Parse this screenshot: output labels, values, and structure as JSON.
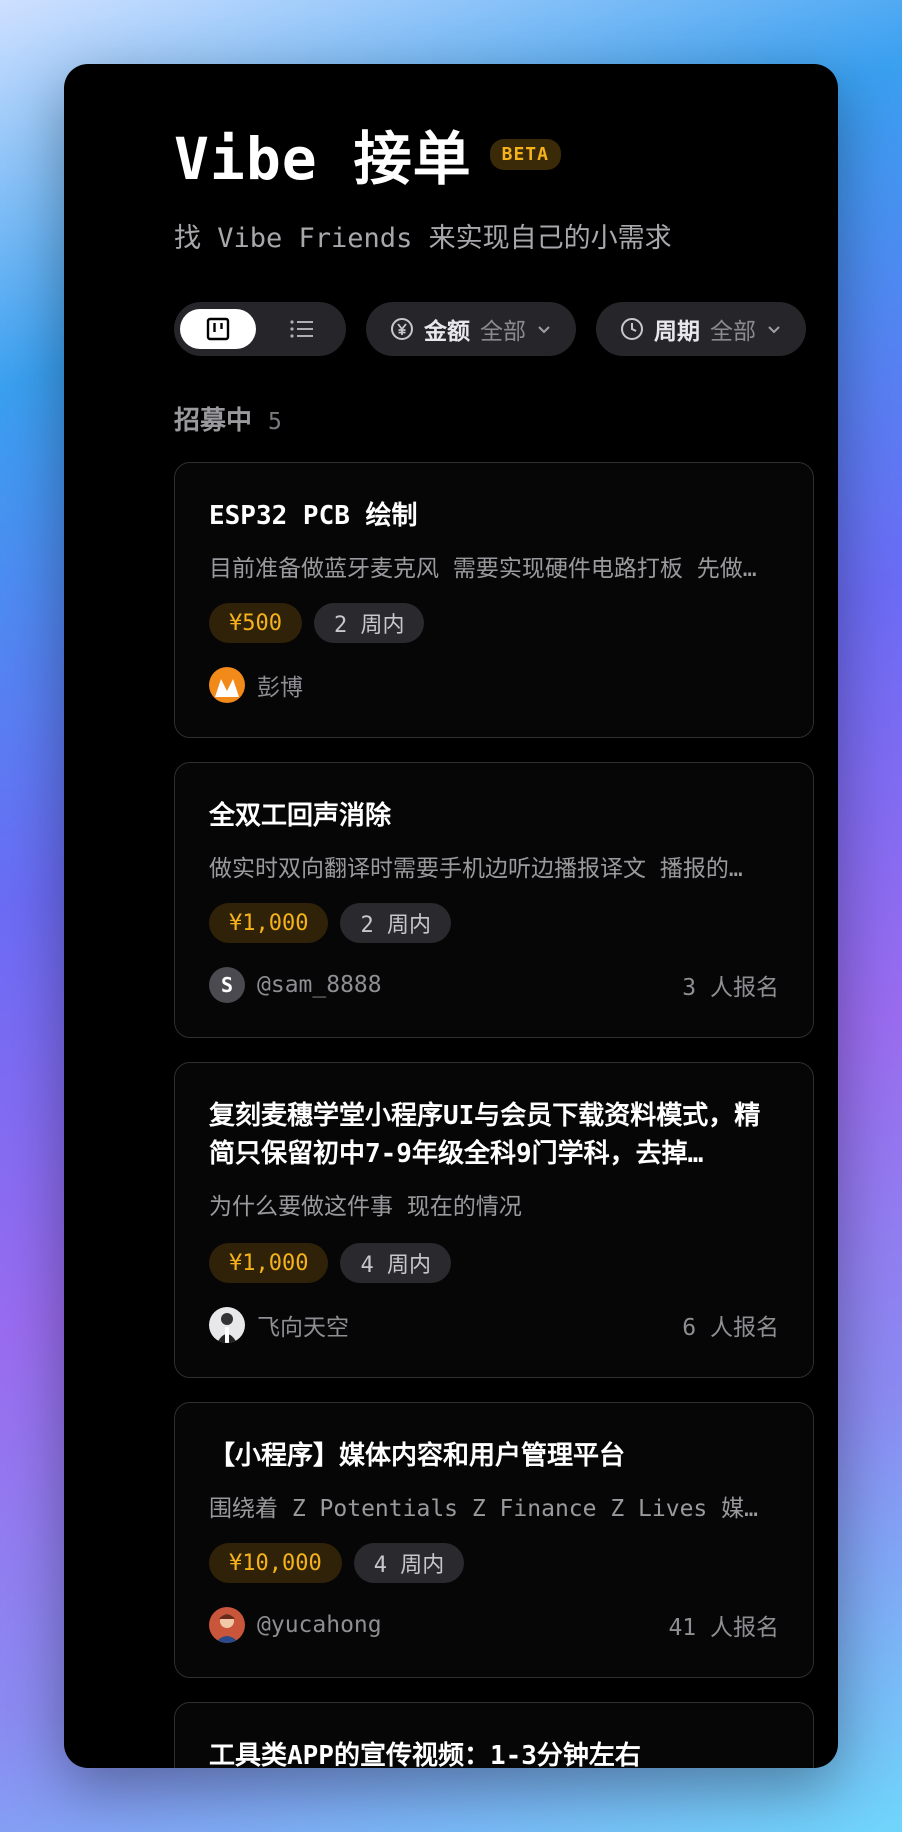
{
  "app": {
    "title": "Vibe 接单",
    "badge": "BETA",
    "subtitle": "找 Vibe Friends 来实现自己的小需求"
  },
  "filters": {
    "view_toggle": {
      "active": "grid-view",
      "options": [
        "grid-view-icon",
        "list-view-icon"
      ]
    },
    "amount": {
      "label": "金额",
      "value": "全部",
      "icon": "yuan-circle-icon"
    },
    "period": {
      "label": "周期",
      "value": "全部",
      "icon": "clock-icon"
    }
  },
  "section": {
    "title": "招募中",
    "count": "5"
  },
  "cards": [
    {
      "title": "ESP32 PCB 绘制",
      "desc": "目前准备做蓝牙麦克风  需要实现硬件电路打板  先做…",
      "price": "¥500",
      "period": "2 周内",
      "author": "彭博",
      "signups": ""
    },
    {
      "title": "全双工回声消除",
      "desc": "做实时双向翻译时需要手机边听边播报译文  播报的…",
      "price": "¥1,000",
      "period": "2 周内",
      "author": "@sam_8888",
      "signups": "3 人报名",
      "avatar_letter": "S"
    },
    {
      "title": "复刻麦穗学堂小程序UI与会员下载资料模式，精简只保留初中7-9年级全科9门学科，去掉…",
      "desc": "为什么要做这件事  现在的情况",
      "price": "¥1,000",
      "period": "4 周内",
      "author": "飞向天空",
      "signups": "6 人报名"
    },
    {
      "title": "【小程序】媒体内容和用户管理平台",
      "desc": "围绕着 Z Potentials Z Finance Z Lives 媒…",
      "price": "¥10,000",
      "period": "4 周内",
      "author": "@yucahong",
      "signups": "41 人报名"
    },
    {
      "title": "工具类APP的宣传视频：1-3分钟左右"
    }
  ],
  "colors": {
    "accent": "#f5b21a",
    "background": "#000000",
    "card_border": "#2e2e33"
  }
}
